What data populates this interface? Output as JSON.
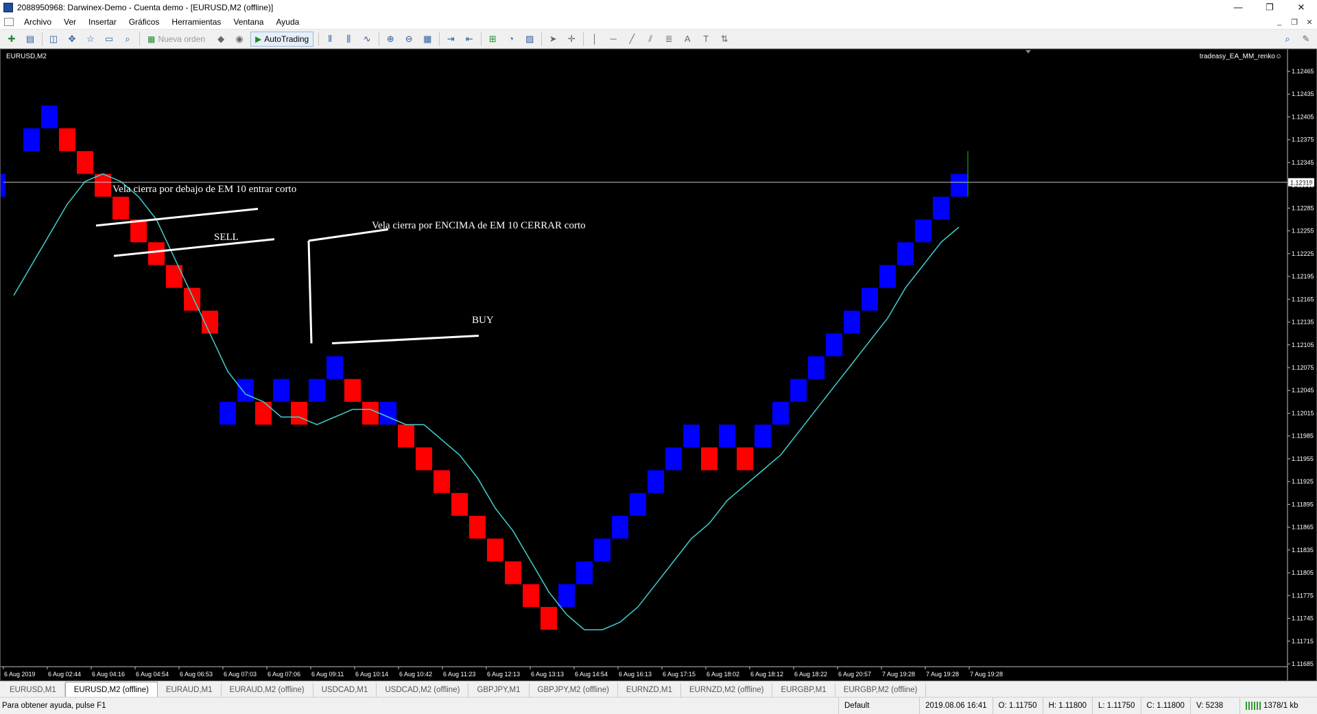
{
  "window": {
    "title": "2088950968: Darwinex-Demo - Cuenta demo - [EURUSD,M2 (offline)]",
    "buttons": [
      "—",
      "❐",
      "✕"
    ]
  },
  "menu": {
    "items": [
      "Archivo",
      "Ver",
      "Insertar",
      "Gráficos",
      "Herramientas",
      "Ventana",
      "Ayuda"
    ],
    "mdi_buttons": [
      "_",
      "❐",
      "✕"
    ]
  },
  "toolbar": {
    "new_order_label": "Nueva orden",
    "autotrading_label": "AutoTrading"
  },
  "chart": {
    "symbol_label": "EURUSD,M2",
    "ea_label": "tradeasy_EA_MM_renko☺",
    "current_price": "1.12319",
    "colors": {
      "background": "#000000",
      "bull": "#0000ff",
      "bear": "#ff0000",
      "ma": "#40d0d0",
      "annotation": "#ffffff"
    },
    "annotations": {
      "sell_entry": "Vela cierra por debajo de EM 10 entrar corto",
      "sell": "SELL",
      "close_short": "Vela cierra por ENCIMA de EM 10 CERRAR corto",
      "buy": "BUY"
    }
  },
  "chart_data": {
    "type": "renko",
    "instrument": "EURUSD,M2",
    "box_size": 0.0003,
    "ylim": [
      1.1166,
      1.1249
    ],
    "y_ticks": [
      "1.12465",
      "1.12435",
      "1.12405",
      "1.12375",
      "1.12345",
      "1.12315",
      "1.12285",
      "1.12255",
      "1.12225",
      "1.12195",
      "1.12165",
      "1.12135",
      "1.12105",
      "1.12075",
      "1.12045",
      "1.12015",
      "1.11985",
      "1.11955",
      "1.11925",
      "1.11895",
      "1.11865",
      "1.11835",
      "1.11805",
      "1.11775",
      "1.11745",
      "1.11715",
      "1.11685"
    ],
    "x_ticks": [
      "6 Aug 2019",
      "6 Aug 02:44",
      "6 Aug 04:16",
      "6 Aug 04:54",
      "6 Aug 06:53",
      "6 Aug 07:03",
      "6 Aug 07:06",
      "6 Aug 09:11",
      "6 Aug 10:14",
      "6 Aug 10:42",
      "6 Aug 11:23",
      "6 Aug 12:13",
      "6 Aug 13:13",
      "6 Aug 14:54",
      "6 Aug 16:13",
      "6 Aug 17:15",
      "6 Aug 18:02",
      "6 Aug 18:12",
      "6 Aug 18:22",
      "6 Aug 20:57",
      "7 Aug 19:28",
      "7 Aug 19:28",
      "7 Aug 19:28"
    ],
    "bricks": [
      {
        "dir": "up",
        "open": 1.123,
        "close": 1.1233
      },
      {
        "dir": "up",
        "open": 1.1236,
        "close": 1.1239
      },
      {
        "dir": "up",
        "open": 1.1239,
        "close": 1.1242
      },
      {
        "dir": "down",
        "open": 1.1239,
        "close": 1.1236
      },
      {
        "dir": "down",
        "open": 1.1236,
        "close": 1.1233
      },
      {
        "dir": "down",
        "open": 1.1233,
        "close": 1.123
      },
      {
        "dir": "down",
        "open": 1.123,
        "close": 1.1227
      },
      {
        "dir": "down",
        "open": 1.1227,
        "close": 1.1224
      },
      {
        "dir": "down",
        "open": 1.1224,
        "close": 1.1221
      },
      {
        "dir": "down",
        "open": 1.1221,
        "close": 1.1218
      },
      {
        "dir": "down",
        "open": 1.1218,
        "close": 1.1215
      },
      {
        "dir": "down",
        "open": 1.1215,
        "close": 1.1212
      },
      {
        "dir": "up",
        "open": 1.12,
        "close": 1.1203
      },
      {
        "dir": "up",
        "open": 1.1203,
        "close": 1.1206
      },
      {
        "dir": "down",
        "open": 1.1203,
        "close": 1.12
      },
      {
        "dir": "up",
        "open": 1.1203,
        "close": 1.1206
      },
      {
        "dir": "down",
        "open": 1.1203,
        "close": 1.12
      },
      {
        "dir": "up",
        "open": 1.1203,
        "close": 1.1206
      },
      {
        "dir": "up",
        "open": 1.1206,
        "close": 1.1209
      },
      {
        "dir": "down",
        "open": 1.1206,
        "close": 1.1203
      },
      {
        "dir": "down",
        "open": 1.1203,
        "close": 1.12
      },
      {
        "dir": "up",
        "open": 1.12,
        "close": 1.1203
      },
      {
        "dir": "down",
        "open": 1.12,
        "close": 1.1197
      },
      {
        "dir": "down",
        "open": 1.1197,
        "close": 1.1194
      },
      {
        "dir": "down",
        "open": 1.1194,
        "close": 1.1191
      },
      {
        "dir": "down",
        "open": 1.1191,
        "close": 1.1188
      },
      {
        "dir": "down",
        "open": 1.1188,
        "close": 1.1185
      },
      {
        "dir": "down",
        "open": 1.1185,
        "close": 1.1182
      },
      {
        "dir": "down",
        "open": 1.1182,
        "close": 1.1179
      },
      {
        "dir": "down",
        "open": 1.1179,
        "close": 1.1176
      },
      {
        "dir": "down",
        "open": 1.1176,
        "close": 1.1173
      },
      {
        "dir": "up",
        "open": 1.1176,
        "close": 1.1179
      },
      {
        "dir": "up",
        "open": 1.1179,
        "close": 1.1182
      },
      {
        "dir": "up",
        "open": 1.1182,
        "close": 1.1185
      },
      {
        "dir": "up",
        "open": 1.1185,
        "close": 1.1188
      },
      {
        "dir": "up",
        "open": 1.1188,
        "close": 1.1191
      },
      {
        "dir": "up",
        "open": 1.1191,
        "close": 1.1194
      },
      {
        "dir": "up",
        "open": 1.1194,
        "close": 1.1197
      },
      {
        "dir": "up",
        "open": 1.1197,
        "close": 1.12
      },
      {
        "dir": "down",
        "open": 1.1197,
        "close": 1.1194
      },
      {
        "dir": "up",
        "open": 1.1197,
        "close": 1.12
      },
      {
        "dir": "down",
        "open": 1.1197,
        "close": 1.1194
      },
      {
        "dir": "up",
        "open": 1.1197,
        "close": 1.12
      },
      {
        "dir": "up",
        "open": 1.12,
        "close": 1.1203
      },
      {
        "dir": "up",
        "open": 1.1203,
        "close": 1.1206
      },
      {
        "dir": "up",
        "open": 1.1206,
        "close": 1.1209
      },
      {
        "dir": "up",
        "open": 1.1209,
        "close": 1.1212
      },
      {
        "dir": "up",
        "open": 1.1212,
        "close": 1.1215
      },
      {
        "dir": "up",
        "open": 1.1215,
        "close": 1.1218
      },
      {
        "dir": "up",
        "open": 1.1218,
        "close": 1.1221
      },
      {
        "dir": "up",
        "open": 1.1221,
        "close": 1.1224
      },
      {
        "dir": "up",
        "open": 1.1224,
        "close": 1.1227
      },
      {
        "dir": "up",
        "open": 1.1227,
        "close": 1.123
      },
      {
        "dir": "up",
        "open": 1.123,
        "close": 1.1233
      }
    ],
    "ma_series": {
      "period": 10,
      "values": [
        1.1217,
        1.1221,
        1.1225,
        1.1229,
        1.1232,
        1.1233,
        1.1232,
        1.123,
        1.1227,
        1.1222,
        1.1217,
        1.1212,
        1.1207,
        1.1204,
        1.1203,
        1.1201,
        1.1201,
        1.12,
        1.1201,
        1.1202,
        1.1202,
        1.1201,
        1.12,
        1.12,
        1.1198,
        1.1196,
        1.1193,
        1.1189,
        1.1186,
        1.1182,
        1.1178,
        1.1175,
        1.1173,
        1.1173,
        1.1174,
        1.1176,
        1.1179,
        1.1182,
        1.1185,
        1.1187,
        1.119,
        1.1192,
        1.1194,
        1.1196,
        1.1199,
        1.1202,
        1.1205,
        1.1208,
        1.1211,
        1.1214,
        1.1218,
        1.1221,
        1.1224,
        1.1226
      ]
    }
  },
  "tabs": [
    "EURUSD,M1",
    "EURUSD,M2 (offline)",
    "EURAUD,M1",
    "EURAUD,M2 (offline)",
    "USDCAD,M1",
    "USDCAD,M2 (offline)",
    "GBPJPY,M1",
    "GBPJPY,M2 (offline)",
    "EURNZD,M1",
    "EURNZD,M2 (offline)",
    "EURGBP,M1",
    "EURGBP,M2 (offline)"
  ],
  "status": {
    "help": "Para obtener ayuda, pulse F1",
    "profile": "Default",
    "datetime": "2019.08.06 16:41",
    "open": "O: 1.11750",
    "high": "H: 1.11800",
    "low": "L: 1.11750",
    "close": "C: 1.11800",
    "volume": "V: 5238",
    "connection": "1378/1 kb"
  }
}
